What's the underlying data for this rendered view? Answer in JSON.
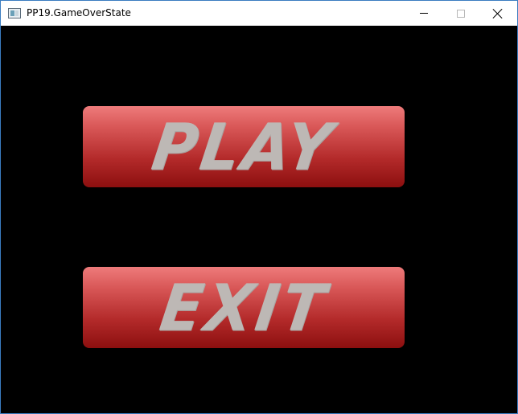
{
  "window": {
    "title": "PP19.GameOverState",
    "icon": "app-window-icon",
    "controls": {
      "minimize_icon": "minimize-icon",
      "maximize_icon": "maximize-icon",
      "close_icon": "close-icon"
    }
  },
  "menu": {
    "play_label": "PLAY",
    "exit_label": "EXIT"
  },
  "colors": {
    "background": "#000000",
    "button_top": "#ee7b7b",
    "button_bottom": "#8c0f0f",
    "button_text": "#bdb8b5"
  }
}
